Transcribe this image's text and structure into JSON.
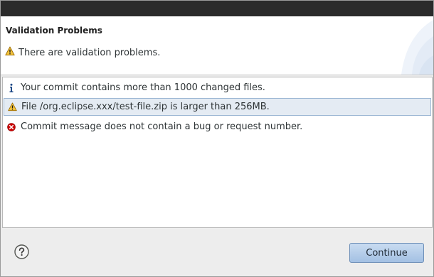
{
  "dialog": {
    "title": "Validation Problems",
    "summary": "There are validation problems.",
    "summary_icon": "warning-icon"
  },
  "problems": [
    {
      "severity": "info",
      "icon": "info-icon",
      "message": "Your commit contains more than 1000 changed files.",
      "selected": false
    },
    {
      "severity": "warning",
      "icon": "warning-icon",
      "message": "File /org.eclipse.xxx/test-file.zip is larger than 256MB.",
      "selected": true
    },
    {
      "severity": "error",
      "icon": "error-icon",
      "message": "Commit message does not contain a bug or request number.",
      "selected": false
    }
  ],
  "footer": {
    "help_icon": "help-icon",
    "continue_label": "Continue"
  },
  "colors": {
    "selection_bg": "#e4ebf3",
    "selection_border": "#9bb6d3",
    "button_gradient_top": "#c9dcf1",
    "button_gradient_bottom": "#a3c0e3",
    "warning": "#f0b429",
    "error": "#cc0000",
    "info": "#204a87"
  }
}
